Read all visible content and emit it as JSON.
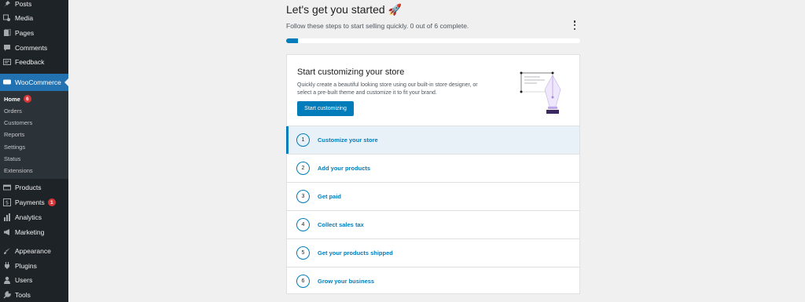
{
  "sidebar": {
    "items_top": [
      {
        "label": "Posts",
        "icon": "pin-icon"
      },
      {
        "label": "Media",
        "icon": "media-icon"
      },
      {
        "label": "Pages",
        "icon": "pages-icon"
      },
      {
        "label": "Comments",
        "icon": "comment-icon"
      },
      {
        "label": "Feedback",
        "icon": "feedback-icon"
      }
    ],
    "woocommerce": {
      "label": "WooCommerce",
      "icon": "woo-icon"
    },
    "submenu": [
      {
        "label": "Home",
        "badge": "6"
      },
      {
        "label": "Orders"
      },
      {
        "label": "Customers"
      },
      {
        "label": "Reports"
      },
      {
        "label": "Settings"
      },
      {
        "label": "Status"
      },
      {
        "label": "Extensions"
      }
    ],
    "items_bottom": [
      {
        "label": "Products",
        "icon": "products-icon"
      },
      {
        "label": "Payments",
        "icon": "payments-icon",
        "badge": "1"
      },
      {
        "label": "Analytics",
        "icon": "analytics-icon"
      },
      {
        "label": "Marketing",
        "icon": "megaphone-icon"
      },
      {
        "label": "Appearance",
        "icon": "brush-icon"
      },
      {
        "label": "Plugins",
        "icon": "plugin-icon"
      },
      {
        "label": "Users",
        "icon": "users-icon"
      },
      {
        "label": "Tools",
        "icon": "wrench-icon"
      }
    ]
  },
  "main": {
    "title": "Let's get you started 🚀",
    "subtitle": "Follow these steps to start selling quickly. 0 out of 6 complete.",
    "progress_fraction": 0.04,
    "accent_color": "#007cba",
    "hero": {
      "title": "Start customizing your store",
      "description": "Quickly create a beautiful looking store using our built-in store designer, or select a pre-built theme and customize it to fit your brand.",
      "button": "Start customizing"
    },
    "tasks": [
      {
        "num": "1",
        "label": "Customize your store"
      },
      {
        "num": "2",
        "label": "Add your products"
      },
      {
        "num": "3",
        "label": "Get paid"
      },
      {
        "num": "4",
        "label": "Collect sales tax"
      },
      {
        "num": "5",
        "label": "Get your products shipped"
      },
      {
        "num": "6",
        "label": "Grow your business"
      }
    ]
  }
}
